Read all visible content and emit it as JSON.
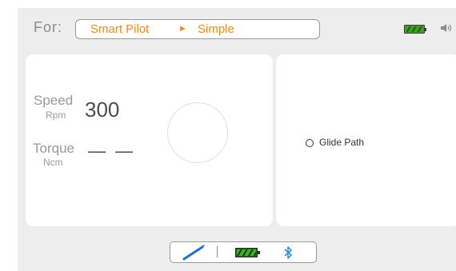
{
  "header": {
    "for_label": "For:",
    "mode_primary": "Smart Pilot",
    "mode_arrow": "►",
    "mode_secondary": "Simple"
  },
  "status_icons": {
    "battery": "battery-full-icon",
    "sound": "speaker-icon"
  },
  "readouts": {
    "speed_label": "Speed",
    "speed_unit": "Rpm",
    "speed_value": "300",
    "torque_label": "Torque",
    "torque_unit": "Ncm",
    "torque_value": "— —"
  },
  "options": {
    "glide_path": "Glide Path"
  },
  "footer": {
    "handpiece_icon": "handpiece-icon",
    "battery_icon": "battery-icon",
    "bluetooth_icon": "bluetooth-icon"
  },
  "colors": {
    "accent": "#ef8a17",
    "battery_green": "#3f9f27",
    "bluetooth_blue": "#2a8fd6",
    "handpiece_blue": "#1a6fd0",
    "background": "#ededed"
  }
}
